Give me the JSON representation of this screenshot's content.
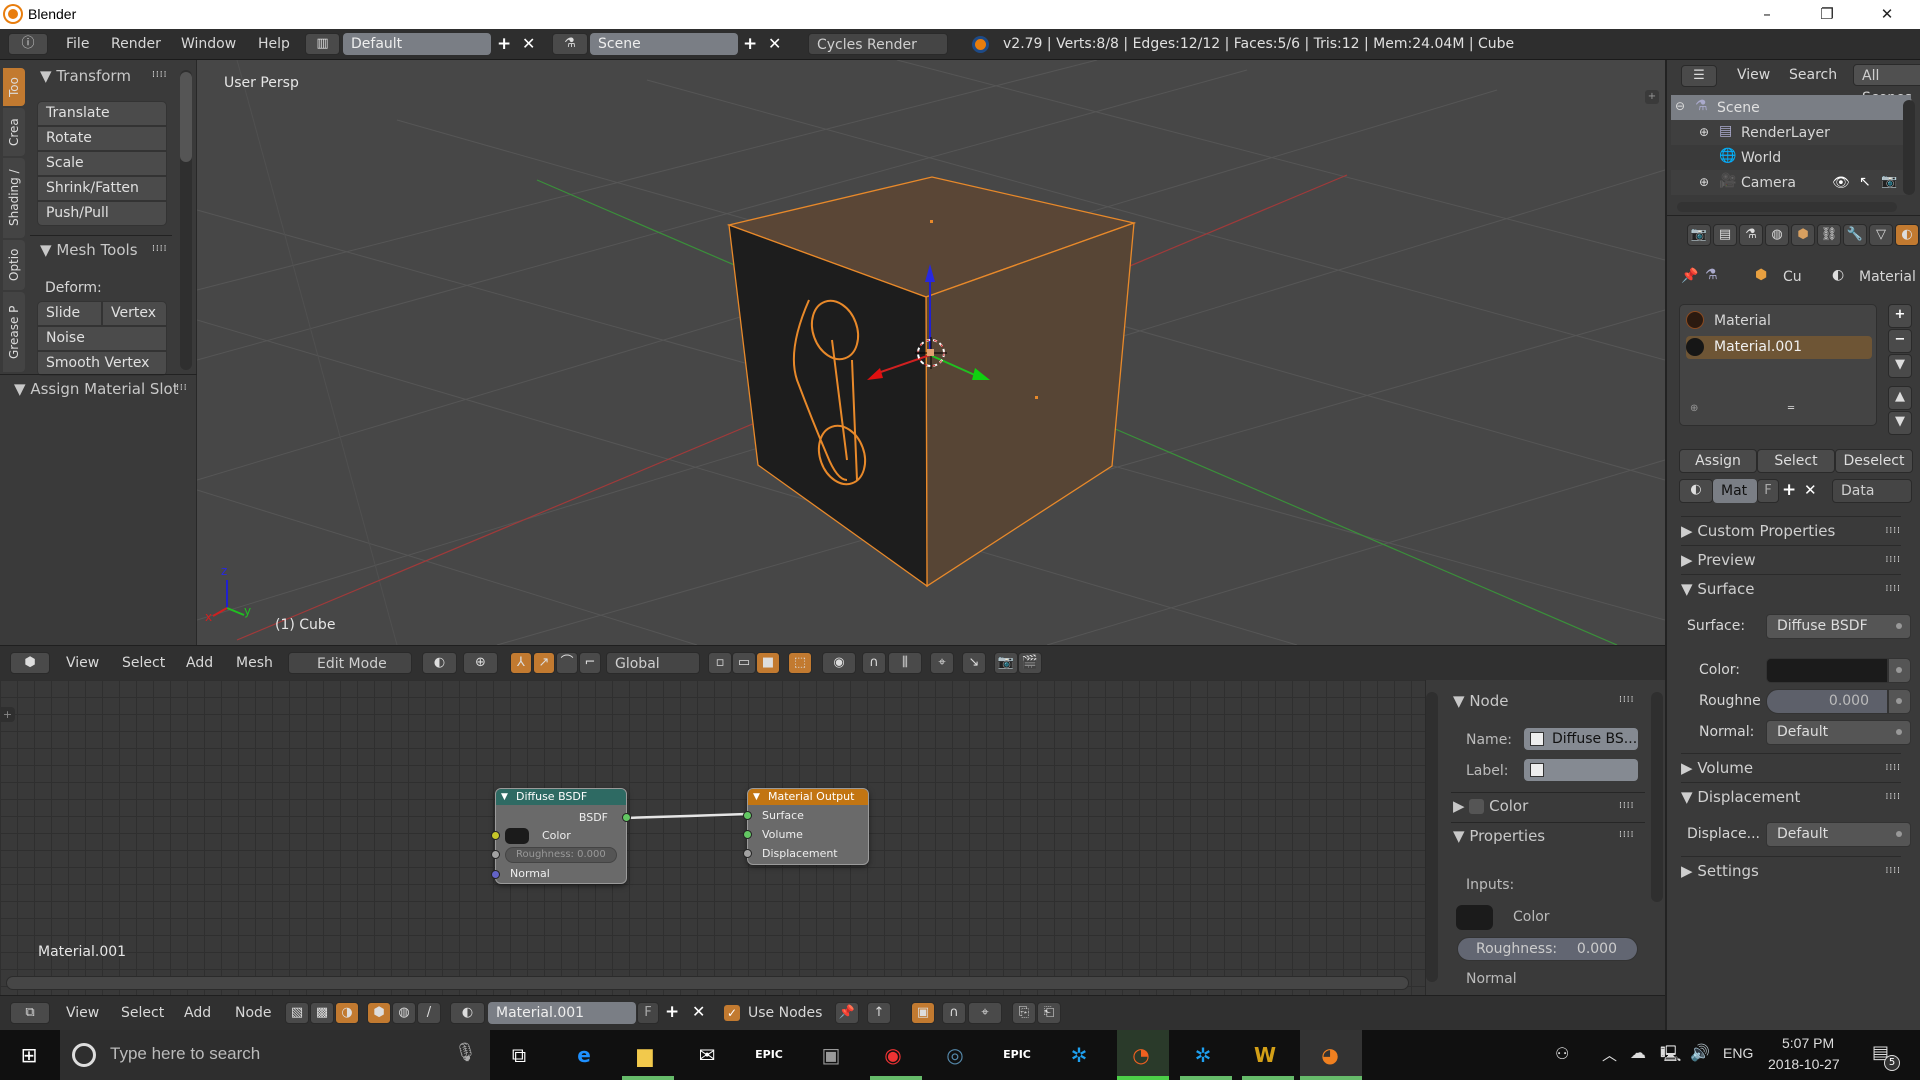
{
  "window": {
    "title": "Blender",
    "minimize": "–",
    "maximize": "❐",
    "close": "✕"
  },
  "infobar": {
    "menus": [
      "File",
      "Render",
      "Window",
      "Help"
    ],
    "layout_name": "Default",
    "scene_name": "Scene",
    "engine": "Cycles Render",
    "stats": "v2.79 | Verts:8/8 | Edges:12/12 | Faces:5/6 | Tris:12 | Mem:24.04M | Cube"
  },
  "toolshelf": {
    "tabs": [
      "Too",
      "Crea",
      "Shading /",
      "Optio",
      "Grease P"
    ],
    "transform": {
      "title": "Transform",
      "buttons": [
        "Translate",
        "Rotate",
        "Scale",
        "Shrink/Fatten",
        "Push/Pull"
      ]
    },
    "mesh_tools": {
      "title": "Mesh Tools",
      "deform_label": "Deform:",
      "row1": [
        "Slide Ed",
        "Vertex"
      ],
      "buttons": [
        "Noise",
        "Smooth Vertex"
      ]
    },
    "assign_material_slot": "Assign Material Slot"
  },
  "viewport": {
    "view_label": "User Persp",
    "object_label": "(1) Cube",
    "axes": {
      "x": "x",
      "y": "y",
      "z": "z"
    },
    "colors": {
      "selected_edge": "#e8892a",
      "face_selected": "#5a4636",
      "face_unselected": "#1d1d1d",
      "grid": "#555555",
      "x_axis": "#c03030",
      "y_axis": "#30a030",
      "z_axis": "#2020d0"
    }
  },
  "viewport_header": {
    "menus": [
      "View",
      "Select",
      "Add",
      "Mesh"
    ],
    "mode": "Edit Mode",
    "orientation": "Global"
  },
  "node_editor": {
    "material_label": "Material.001",
    "nodes": {
      "diffuse": {
        "title": "Diffuse BSDF",
        "output": "BSDF",
        "inputs": [
          "Color",
          "Roughness: 0.000",
          "Normal"
        ]
      },
      "output": {
        "title": "Material Output",
        "inputs": [
          "Surface",
          "Volume",
          "Displacement"
        ]
      }
    },
    "colors": {
      "shader_header": "#2e6a63",
      "output_header": "#c27512"
    }
  },
  "npanel": {
    "node_title": "Node",
    "name_label": "Name:",
    "name_value": "Diffuse BS...",
    "label_label": "Label:",
    "label_value": "",
    "color_section": "Color",
    "properties_section": "Properties",
    "inputs_label": "Inputs:",
    "color_label": "Color",
    "roughness_label": "Roughness:",
    "roughness_value": "0.000",
    "normal_label": "Normal"
  },
  "node_header": {
    "menus": [
      "View",
      "Select",
      "Add",
      "Node"
    ],
    "material": "Material.001",
    "fake_user": "F",
    "use_nodes_label": "Use Nodes",
    "use_nodes_checked": true
  },
  "outliner": {
    "menus": [
      "View",
      "Search"
    ],
    "filter": "All Scenes",
    "items": [
      "Scene",
      "RenderLayer",
      "World",
      "Camera"
    ]
  },
  "properties": {
    "breadcrumb": [
      "Cu",
      "Material"
    ],
    "slots": [
      "Material",
      "Material.001"
    ],
    "selected_slot": "Material.001",
    "slot_actions": [
      "Assign",
      "Select",
      "Deselect"
    ],
    "mat_field": "Mat",
    "fake_user": "F",
    "link": "Data",
    "sections": {
      "custom_properties": "Custom Properties",
      "preview": "Preview",
      "surface": "Surface",
      "volume": "Volume",
      "displacement": "Displacement",
      "settings": "Settings"
    },
    "surface_label": "Surface:",
    "surface_value": "Diffuse BSDF",
    "color_label": "Color:",
    "roughness_label": "Roughne",
    "roughness_value": "0.000",
    "normal_label": "Normal:",
    "normal_value": "Default",
    "displacement_label": "Displace...",
    "displacement_value": "Default"
  },
  "taskbar": {
    "search_placeholder": "Type here to search",
    "language": "ENG",
    "time": "5:07 PM",
    "date": "2018-10-27",
    "notifications": "5"
  }
}
